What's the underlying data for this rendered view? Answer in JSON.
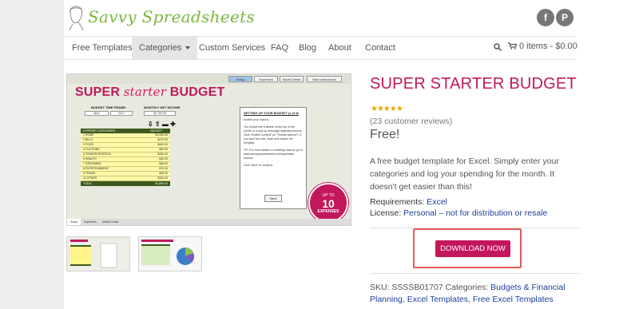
{
  "brand": {
    "name": "Savvy Spreadsheets",
    "accent": "#c2185b",
    "logo_green": "#7ab83f"
  },
  "social": [
    {
      "icon": "facebook-icon",
      "glyph": "f"
    },
    {
      "icon": "pinterest-icon",
      "glyph": "P"
    }
  ],
  "nav": {
    "items": [
      "Free Templates",
      "Categories",
      "Custom Services",
      "FAQ",
      "Blog",
      "About",
      "Contact"
    ],
    "active": "Categories",
    "cart_label": "0 items - $0.00"
  },
  "spreadsheet": {
    "tabs": [
      "Setup",
      "Expenses",
      "Month Detail",
      "Hide Instructions"
    ],
    "title_a": "SUPER ",
    "title_b": "starter",
    "title_c": " BUDGET",
    "budget_time_label": "BUDGET TIME FRAME:",
    "month": "MAY",
    "year": "2017",
    "income_label": "MONTHLY NET INCOME",
    "income": "$2,700.00",
    "table_header": [
      "EXPENSE CATEGORIES",
      "BUDGET"
    ],
    "rows": [
      {
        "name": "1 HOME",
        "amount": "$1,050.00"
      },
      {
        "name": "2 BILLS",
        "amount": "$170.00"
      },
      {
        "name": "3 FOOD",
        "amount": "$400.00"
      },
      {
        "name": "4 CLOTHING",
        "amount": "$50.00"
      },
      {
        "name": "5 TRANSPORTATION",
        "amount": "$150.00"
      },
      {
        "name": "6 HEALTH",
        "amount": "$30.00"
      },
      {
        "name": "7 GROOMING",
        "amount": "$45.00"
      },
      {
        "name": "8 ENTERTAINMENT",
        "amount": "$70.00"
      },
      {
        "name": "9 TRAVEL",
        "amount": "$35.00"
      },
      {
        "name": "10 OTHER",
        "amount": "$200.00"
      }
    ],
    "total_label": "TOTAL",
    "total": "$1,850.00",
    "panel_title": "SETTING UP YOUR BUDGET (1 of 5)",
    "panel_lines": [
      "Enable your macros.",
      "You should see a banner at the top of the screen or a pop-up message regarding macros. Click \"Enable Content\" (or \"Enable Macros\"). If you don't see this, close and reopen the template.",
      "TIP: For more details on enabling macros, go to www.savvyspreadsheets.com/faq/enable-macros.",
      "Click \"Next\" to continue."
    ],
    "next_label": "Next",
    "badge": {
      "line1": "UP TO",
      "line2": "10",
      "line3": "EXPENSES"
    },
    "sheet_tabs": [
      "Setup",
      "Expenses",
      "Month Detail"
    ]
  },
  "product": {
    "title": "SUPER STARTER BUDGET",
    "rating": 5,
    "stars": "★★★★★",
    "reviews": "(23 customer reviews)",
    "price": "Free!",
    "description": "A free budget template for Excel. Simply enter your categories and log your spending for the month. It doesn't get easier than this!",
    "requirements_label": "Requirements: ",
    "requirements_value": "Excel",
    "license_label": "License: ",
    "license_value": "Personal – not for distribution or resale",
    "download_label": "DOWNLOAD NOW",
    "sku_label": "SKU: SSSSB01707 Categories: ",
    "category_1": "Budgets & Financial Planning",
    "category_2": "Excel Templates",
    "category_3": "Free Excel Templates",
    "sep": ", "
  }
}
